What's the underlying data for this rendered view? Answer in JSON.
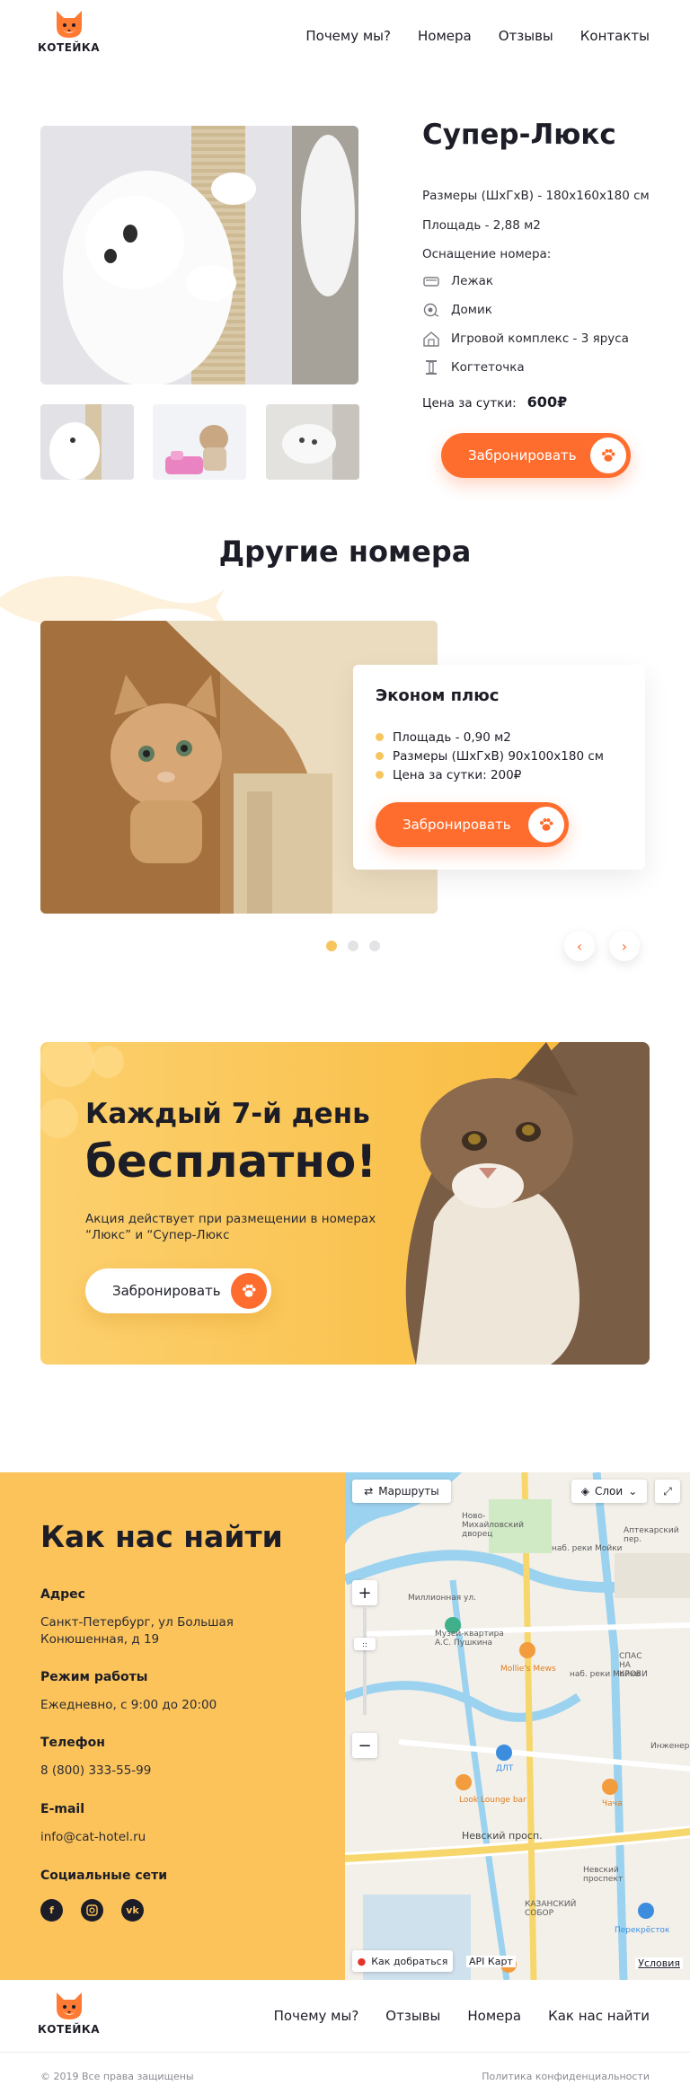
{
  "brand": {
    "logo_text": "КОТЕЙКА"
  },
  "header": {
    "nav": [
      "Почему мы?",
      "Номера",
      "Отзывы",
      "Контакты"
    ]
  },
  "product": {
    "title": "Супер-Люкс",
    "size": "Размеры (ШхГхВ) - 180х160х180 см",
    "area": "Площадь - 2,88 м2",
    "equipment_title": "Оснащение номера:",
    "equipment": [
      {
        "icon": "bed-icon",
        "label": "Лежак"
      },
      {
        "icon": "house-icon",
        "label": "Домик"
      },
      {
        "icon": "play-complex-icon",
        "label": "Игровой комплекс - 3 яруса"
      },
      {
        "icon": "scratching-post-icon",
        "label": "Когтеточка"
      }
    ],
    "price_label": "Цена за сутки:",
    "price_value": "600₽",
    "book_label": "Забронировать"
  },
  "other_rooms": {
    "title": "Другие номера",
    "card": {
      "title": "Эконом плюс",
      "items": [
        "Площадь - 0,90 м2",
        "Размеры (ШхГхВ) 90х100х180 см",
        "Цена за сутки: 200₽"
      ],
      "book_label": "Забронировать"
    },
    "slides": 3,
    "active_slide": 1
  },
  "promo": {
    "line1": "Каждый 7-й день",
    "line2": "бесплатно!",
    "text": "Акция действует при размещении в номерах “Люкс” и “Супер-Люкс",
    "book_label": "Забронировать"
  },
  "contacts": {
    "title": "Как нас найти",
    "address_label": "Адрес",
    "address_line1": "Санкт-Петербург, ул Большая",
    "address_line2": "Конюшенная, д 19",
    "hours_label": "Режим работы",
    "hours_value": "Ежедневно, с 9:00 до 20:00",
    "phone_label": "Телефон",
    "phone_value": "8 (800) 333-55-99",
    "email_label": "E-mail",
    "email_value": "info@cat-hotel.ru",
    "social_label": "Социальные сети",
    "social": [
      "facebook-icon",
      "instagram-icon",
      "vk-icon"
    ]
  },
  "map": {
    "routes": "Маршруты",
    "layers": "Слои",
    "directions": "Как добраться",
    "api": "API Карт",
    "terms": "Условия",
    "labels": [
      "Ново-Михайловский дворец",
      "наб. реки Мойки",
      "Музей-квартира А.С. Пушкина",
      "Mollie's Mews",
      "СПАС НА КРОВИ",
      "ДЛТ",
      "Look Lounge bar",
      "Чача",
      "Невский просп.",
      "Невский проспект",
      "КАЗАНСКИЙ СОБОР",
      "Перекрёсток",
      "Миллионная ул.",
      "наб. реки Мойки",
      "Инженер...",
      "Аптекарский пер."
    ]
  },
  "footer": {
    "nav": [
      "Почему мы?",
      "Отзывы",
      "Номера",
      "Как нас найти"
    ],
    "copyright": "© 2019 Все права защищены",
    "policy": "Политика конфиденциальности"
  },
  "colors": {
    "accent": "#ff6d2e",
    "yellow": "#fcc35a",
    "dot": "#f7c55d",
    "text": "#1c1d27"
  }
}
